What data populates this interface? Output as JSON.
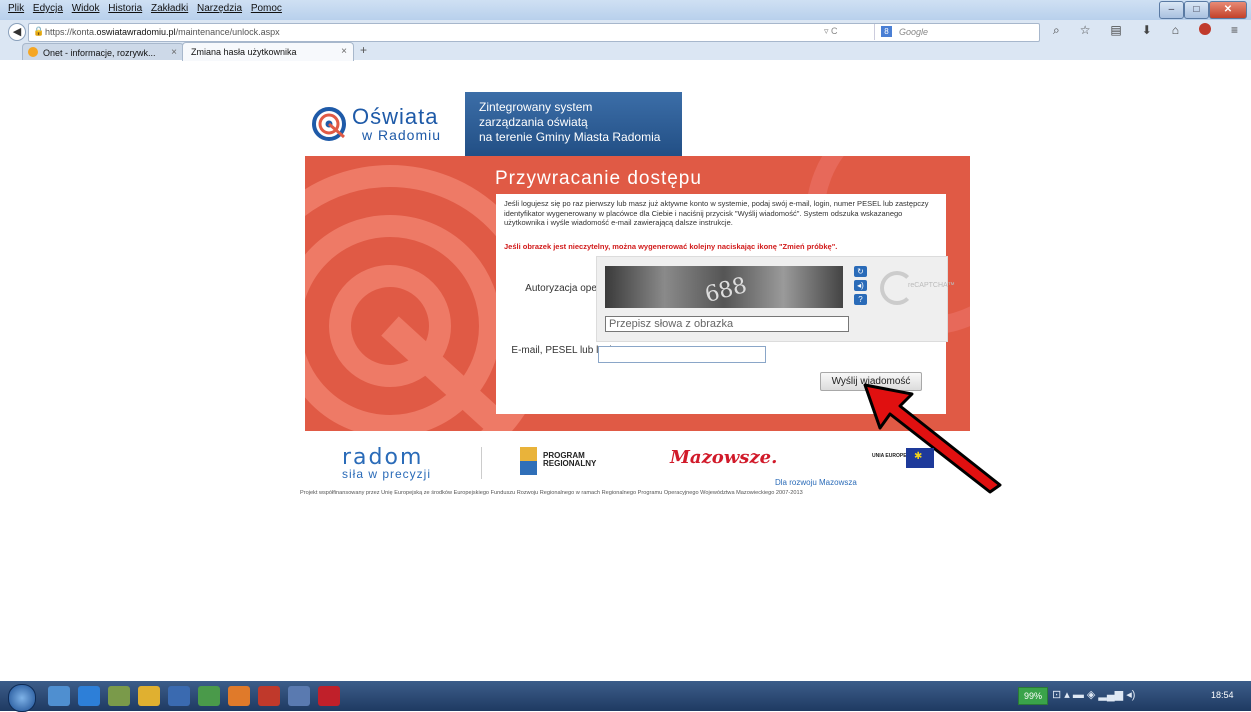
{
  "browser": {
    "menu": [
      "Plik",
      "Edycja",
      "Widok",
      "Historia",
      "Zakładki",
      "Narzędzia",
      "Pomoc"
    ],
    "url_prefix": "https://konta.",
    "url_domain": "oswiatawradomiu.pl",
    "url_path": "/maintenance/unlock.aspx",
    "search_placeholder": "Google",
    "tabs": [
      {
        "label": "Onet - informacje, rozrywk...",
        "close": "×"
      },
      {
        "label": "Zmiana hasła użytkownika",
        "close": "×"
      }
    ],
    "new_tab": "+"
  },
  "header": {
    "logo_title": "Oświata",
    "logo_sub": "w Radomiu",
    "system_lines": [
      "Zintegrowany system",
      "zarządzania oświatą",
      "na terenie Gminy Miasta Radomia"
    ]
  },
  "panel": {
    "title": "Przywracanie dostępu",
    "description": "Jeśli logujesz się po raz pierwszy lub masz już aktywne konto w systemie, podaj swój e-mail, login, numer PESEL lub zastępczy identyfikator wygenerowany w placówce dla Ciebie i naciśnij przycisk \"Wyślij wiadomość\". System odszuka wskazanego użytkownika i wyśle wiadomość e-mail zawierającą dalsze instrukcje.",
    "warning": "Jeśli obrazek jest nieczytelny, można wygenerować kolejny naciskając ikonę \"Zmień próbkę\".",
    "auth_label": "Autoryzacja operacji:",
    "captcha_text": "688",
    "captcha_placeholder": "Przepisz słowa z obrazka",
    "recaptcha_brand": "reCAPTCHA™",
    "email_label": "E-mail, PESEL lub login:",
    "email_value": "",
    "send_button": "Wyślij wiadomość"
  },
  "footer": {
    "radom_title": "radom",
    "radom_sub": "siła w precyzji",
    "program_line1": "PROGRAM",
    "program_line2": "REGIONALNY",
    "mazowsze": "Mazowsze.",
    "ue": "UNIA EUROPEJSKA",
    "dla": "Dla rozwoju Mazowsza",
    "project": "Projekt współfinansowany przez Unię Europejską ze środków Europejskiego Funduszu Rozwoju Regionalnego w ramach Regionalnego Programu Operacyjnego Województwa Mazowieckiego 2007-2013"
  },
  "taskbar": {
    "battery": "99%",
    "clock": "18:54"
  },
  "colors": {
    "panel_red": "#e05a45",
    "header_blue": "#2a5a92",
    "arrow_red": "#e01010"
  }
}
